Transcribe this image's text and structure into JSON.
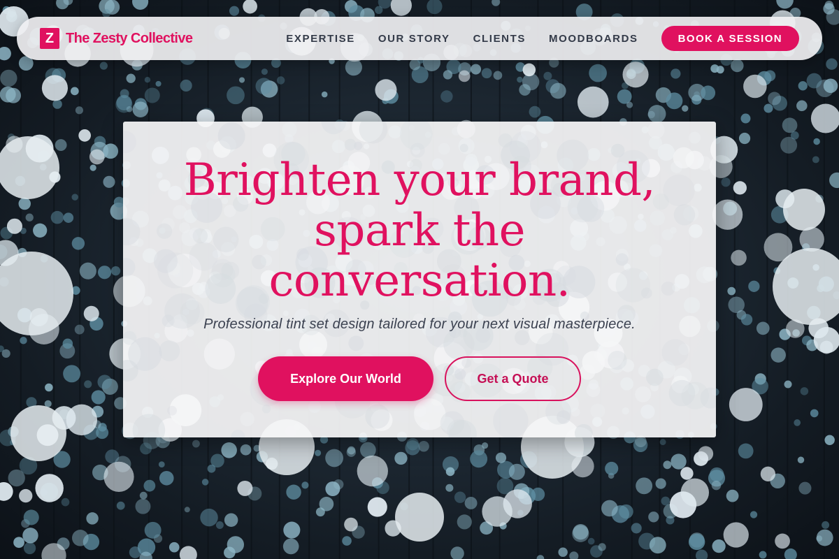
{
  "brand": {
    "mark": "Z",
    "name": "The Zesty Collective"
  },
  "nav": {
    "links": [
      "EXPERTISE",
      "OUR STORY",
      "CLIENTS",
      "MOODBOARDS"
    ],
    "cta_label": "BOOK A SESSION"
  },
  "hero": {
    "headline_line1": "Brighten your brand,",
    "headline_line2": "spark the",
    "headline_line3": "conversation.",
    "subhead": "Professional tint set design tailored for your next visual masterpiece.",
    "primary_label": "Explore Our World",
    "secondary_label": "Get a Quote"
  },
  "colors": {
    "accent": "#e0115f",
    "nav_text": "#333a48",
    "background": "#1a2430"
  },
  "icons": {
    "brand_mark": "z-logo-icon"
  }
}
